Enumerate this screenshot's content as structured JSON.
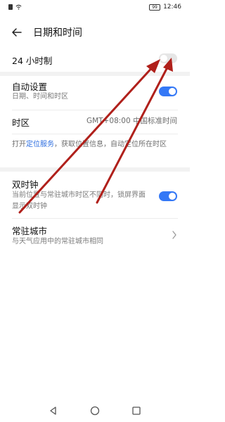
{
  "status_bar": {
    "time": "12:46",
    "battery": "99"
  },
  "header": {
    "title": "日期和时间"
  },
  "settings": {
    "hour24": {
      "label": "24 小时制",
      "enabled": false
    },
    "auto": {
      "title": "自动设置",
      "subtitle": "日期、时间和时区",
      "enabled": true
    },
    "timezone": {
      "label": "时区",
      "value": "GMT+08:00 中国标准时间"
    },
    "location_hint": {
      "prefix": "打开",
      "link": "定位服务",
      "suffix": "，获取位置信息，自动定位所在时区"
    },
    "dual_clock": {
      "title": "双时钟",
      "subtitle": "当前位置与常驻城市时区不同时，锁屏界面显示双时钟",
      "enabled": true
    },
    "home_city": {
      "title": "常驻城市",
      "subtitle": "与天气应用中的常驻城市相同"
    }
  },
  "colors": {
    "accent": "#3478f6",
    "link": "#2f6fe0",
    "annotation_arrow": "#b0201b"
  },
  "icons": {
    "back": "back-arrow-icon",
    "chevron": "chevron-right-icon",
    "nav_back": "triangle-back-icon",
    "nav_home": "circle-home-icon",
    "nav_recent": "square-recent-icon"
  }
}
